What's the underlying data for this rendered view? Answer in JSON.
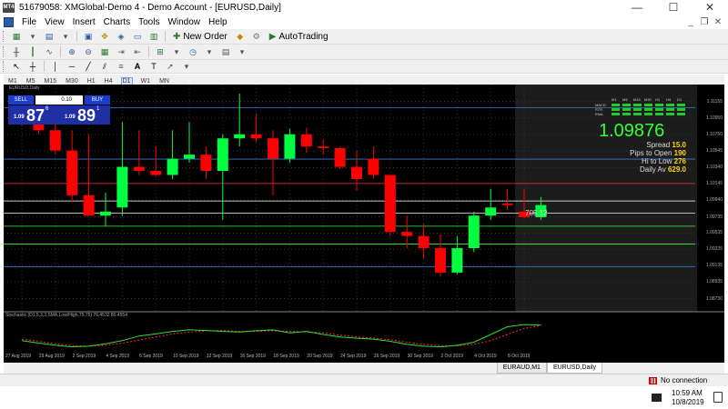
{
  "window": {
    "title": "51679058: XMGlobal-Demo 4 - Demo Account - [EURUSD,Daily]",
    "app_icon_label": "MT4",
    "minimize_icon": "minimize-icon",
    "maximize_icon": "maximize-icon",
    "close_icon": "close-icon"
  },
  "menu": {
    "items": [
      "File",
      "View",
      "Insert",
      "Charts",
      "Tools",
      "Window",
      "Help"
    ]
  },
  "toolbar": {
    "new_order_label": "New Order",
    "autotrading_label": "AutoTrading",
    "timeframes": [
      "M1",
      "M5",
      "M15",
      "M30",
      "H1",
      "H4",
      "D1",
      "W1",
      "MN"
    ],
    "active_timeframe": "D1"
  },
  "chart": {
    "symbol_label": "EURUSD,Daily",
    "one_click": {
      "sell_label": "SELL",
      "buy_label": "BUY",
      "lot": "0.10",
      "sell_prefix": "1.09",
      "sell_big": "87",
      "sell_sup": "6",
      "buy_prefix": "1.09",
      "buy_big": "89",
      "buy_sup": "1"
    },
    "info": {
      "indicator_headers": [
        "M1",
        "M5",
        "M15",
        "M30",
        "H1",
        "H4",
        "D1"
      ],
      "indicator_rows": [
        "MACD",
        "STR",
        "EMA"
      ],
      "price": "1.09876",
      "spread_label": "Spread",
      "spread_value": "15.0",
      "pips_label": "Pips to Open",
      "pips_value": "190",
      "hilo_label": "Hi to Low",
      "hilo_value": "276",
      "daily_label": "Daily Av",
      "daily_value": "629.0"
    },
    "pending_label": "705.12",
    "stochastic_label": "Stochastic (D1,5,3,3,SMA,Low/High,75,75) 76.4532 80.4554",
    "price_labels": [
      "1.11155",
      "1.10950",
      "1.10750",
      "1.10545",
      "1.10340",
      "1.10145",
      "1.09940",
      "1.09735",
      "1.09535",
      "1.09335",
      "1.09135",
      "1.08935",
      "1.08730"
    ],
    "date_labels": [
      "27 Aug 2019",
      "29 Aug 2019",
      "2 Sep 2019",
      "4 Sep 2019",
      "6 Sep 2019",
      "10 Sep 2019",
      "12 Sep 2019",
      "16 Sep 2019",
      "18 Sep 2019",
      "20 Sep 2019",
      "24 Sep 2019",
      "26 Sep 2019",
      "30 Sep 2019",
      "2 Oct 2019",
      "4 Oct 2019",
      "8 Oct 2019"
    ],
    "colors": {
      "bull": "#00ff40",
      "bear": "#ff0000",
      "grid": "#555555",
      "background": "#000000"
    }
  },
  "chart_data": {
    "type": "candlestick",
    "x": [
      "26 Aug 2019",
      "27 Aug 2019",
      "28 Aug 2019",
      "29 Aug 2019",
      "30 Aug 2019",
      "2 Sep 2019",
      "3 Sep 2019",
      "4 Sep 2019",
      "5 Sep 2019",
      "6 Sep 2019",
      "9 Sep 2019",
      "10 Sep 2019",
      "11 Sep 2019",
      "12 Sep 2019",
      "13 Sep 2019",
      "16 Sep 2019",
      "17 Sep 2019",
      "18 Sep 2019",
      "19 Sep 2019",
      "20 Sep 2019",
      "23 Sep 2019",
      "24 Sep 2019",
      "25 Sep 2019",
      "26 Sep 2019",
      "27 Sep 2019",
      "30 Sep 2019",
      "1 Oct 2019",
      "2 Oct 2019",
      "3 Oct 2019",
      "4 Oct 2019",
      "7 Oct 2019",
      "8 Oct 2019"
    ],
    "open": [
      1.1095,
      1.109,
      1.108,
      1.1055,
      1.1,
      1.0975,
      1.0985,
      1.1035,
      1.103,
      1.1025,
      1.1045,
      1.105,
      1.103,
      1.107,
      1.1075,
      1.107,
      1.1045,
      1.1075,
      1.106,
      1.1058,
      1.1035,
      1.1045,
      1.1025,
      1.0955,
      1.095,
      1.0935,
      1.0905,
      1.0935,
      1.0975,
      1.099,
      1.098,
      1.0973
    ],
    "close": [
      1.109,
      1.108,
      1.1055,
      1.1,
      1.0975,
      1.098,
      1.1035,
      1.103,
      1.1025,
      1.1045,
      1.105,
      1.103,
      1.107,
      1.1075,
      1.107,
      1.1045,
      1.1075,
      1.106,
      1.1058,
      1.1035,
      1.102,
      1.1025,
      1.0955,
      1.095,
      1.0935,
      1.0905,
      1.0935,
      1.0975,
      1.0985,
      1.0988,
      1.0973,
      1.0988
    ],
    "high": [
      1.11,
      1.1095,
      1.109,
      1.108,
      1.1075,
      1.1003,
      1.109,
      1.108,
      1.106,
      1.108,
      1.109,
      1.106,
      1.1075,
      1.1125,
      1.11,
      1.108,
      1.1082,
      1.1083,
      1.1068,
      1.106,
      1.1055,
      1.106,
      1.1025,
      1.0975,
      1.0965,
      1.0952,
      1.095,
      1.098,
      1.1008,
      1.1008,
      1.1008,
      1.0998
    ],
    "low": [
      1.1085,
      1.1075,
      1.105,
      1.0992,
      1.0975,
      1.0962,
      1.0975,
      1.1025,
      1.1023,
      1.102,
      1.104,
      1.102,
      1.097,
      1.106,
      1.1065,
      1.1,
      1.104,
      1.1052,
      1.105,
      1.1032,
      1.1005,
      1.102,
      1.095,
      1.0935,
      1.0922,
      1.09,
      1.0903,
      1.093,
      1.097,
      1.0982,
      1.0972,
      1.097
    ],
    "ylim": [
      1.0868,
      1.1125
    ],
    "horizontal_lines": [
      1.11075,
      1.10445,
      1.10145,
      1.0993,
      1.0978,
      1.0962,
      1.094,
      1.0912
    ],
    "stochastic": {
      "name": "Stochastic (D1,5,3,3,SMA,Low/High,75,75)",
      "main": [
        30,
        22,
        15,
        10,
        12,
        20,
        30,
        45,
        52,
        60,
        65,
        63,
        60,
        58,
        62,
        65,
        55,
        60,
        50,
        42,
        38,
        35,
        28,
        18,
        12,
        10,
        15,
        25,
        50,
        75,
        82,
        80
      ],
      "signal": [
        35,
        28,
        20,
        14,
        12,
        15,
        22,
        32,
        42,
        52,
        58,
        62,
        63,
        60,
        60,
        62,
        60,
        58,
        55,
        48,
        42,
        38,
        33,
        25,
        18,
        14,
        13,
        18,
        30,
        50,
        70,
        78
      ],
      "ylim": [
        0,
        100
      ]
    }
  }
}
